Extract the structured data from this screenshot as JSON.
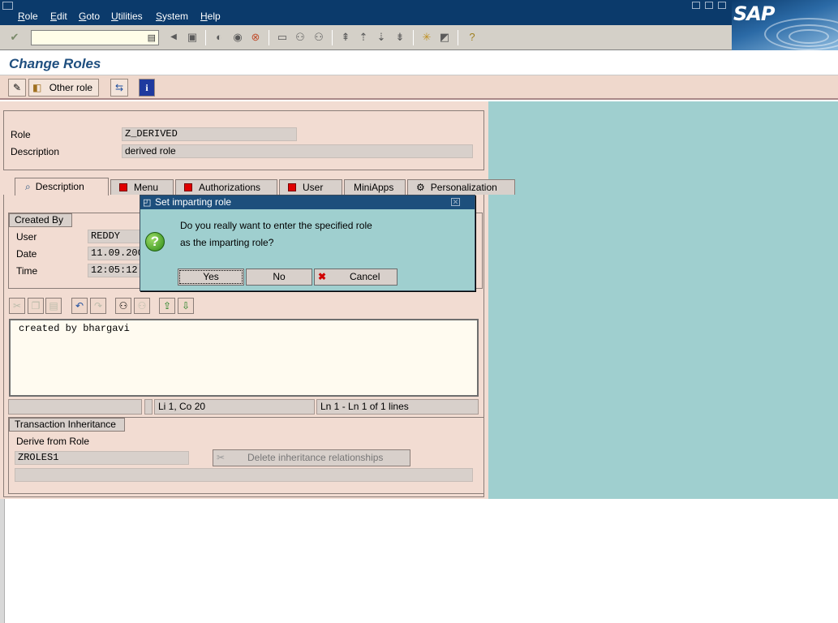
{
  "menubar": {
    "items": [
      "Role",
      "Edit",
      "Goto",
      "Utilities",
      "System",
      "Help"
    ],
    "logo": "SAP"
  },
  "toolbar": {
    "command_field_value": "",
    "icons": [
      "enter-icon",
      "dropdown-icon",
      "back-icon",
      "save-icon",
      "previous-icon",
      "exit-icon",
      "cancel-icon",
      "print-icon",
      "find-icon",
      "find-next-icon",
      "first-page-icon",
      "previous-page-icon",
      "next-page-icon",
      "last-page-icon",
      "create-session-icon",
      "shortcut-icon",
      "help-icon"
    ]
  },
  "page": {
    "title": "Change Roles"
  },
  "app_toolbar": {
    "other_role_label": "Other role"
  },
  "header": {
    "role_label": "Role",
    "role_value": "Z_DERIVED",
    "description_label": "Description",
    "description_value": "derived role"
  },
  "tabs": [
    {
      "label": "Description",
      "active": true
    },
    {
      "label": "Menu",
      "active": false
    },
    {
      "label": "Authorizations",
      "active": false
    },
    {
      "label": "User",
      "active": false
    },
    {
      "label": "MiniApps",
      "active": false
    },
    {
      "label": "Personalization",
      "active": false
    }
  ],
  "created_by": {
    "group_label": "Created By",
    "user_label": "User",
    "user_value": "REDDY",
    "date_label": "Date",
    "date_value": "11.09.200",
    "time_label": "Time",
    "time_value": "12:05:12"
  },
  "editor": {
    "text": "created by bhargavi",
    "status_position": "Li 1, Co 20",
    "status_lines": "Ln 1 - Ln 1 of 1 lines"
  },
  "transaction_inheritance": {
    "group_label": "Transaction Inheritance",
    "derive_label": "Derive from Role",
    "derive_value": "ZROLES1",
    "delete_button_label": "Delete inheritance relationships"
  },
  "dialog": {
    "title": "Set imparting role",
    "message_line1": "Do you really want to enter the specified role",
    "message_line2": "as the imparting role?",
    "yes_label": "Yes",
    "no_label": "No",
    "cancel_label": "Cancel"
  },
  "colors": {
    "menubar": "#0b3a6b",
    "content_pink": "#f2dcd2",
    "background_teal": "#9fcfcf",
    "title_blue": "#1f4f7f"
  }
}
